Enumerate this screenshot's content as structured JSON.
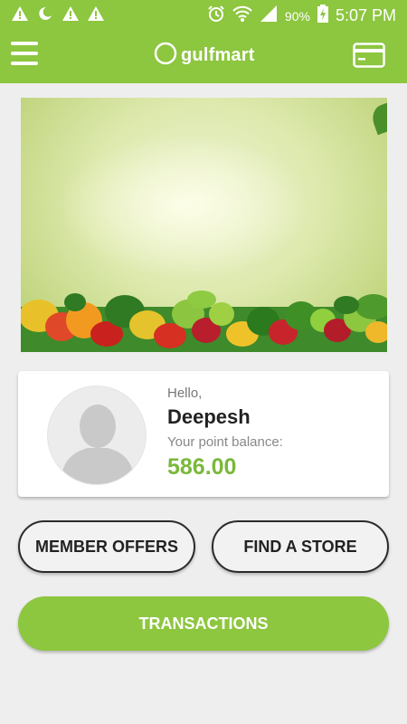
{
  "status_bar": {
    "icons": [
      "warning-icon",
      "night-mode-icon",
      "warning-icon",
      "warning-icon",
      "alarm-icon",
      "wifi-icon",
      "signal-icon",
      "battery-charging-icon"
    ],
    "battery": "90%",
    "time": "5:07 PM"
  },
  "app_bar": {
    "logo_text": "gulfmart",
    "menu_icon": "hamburger-menu-icon",
    "card_icon": "loyalty-card-icon",
    "color": "#8dc63f"
  },
  "banner": {
    "slides": 2,
    "active_slide": 2
  },
  "profile": {
    "greeting": "Hello,",
    "name": "Deepesh",
    "points_label": "Your point balance:",
    "points_value": "586.00",
    "points_color": "#7ab83b"
  },
  "actions": {
    "member_offers": "MEMBER OFFERS",
    "find_store": "FIND A STORE",
    "transactions": "TRANSACTIONS"
  }
}
